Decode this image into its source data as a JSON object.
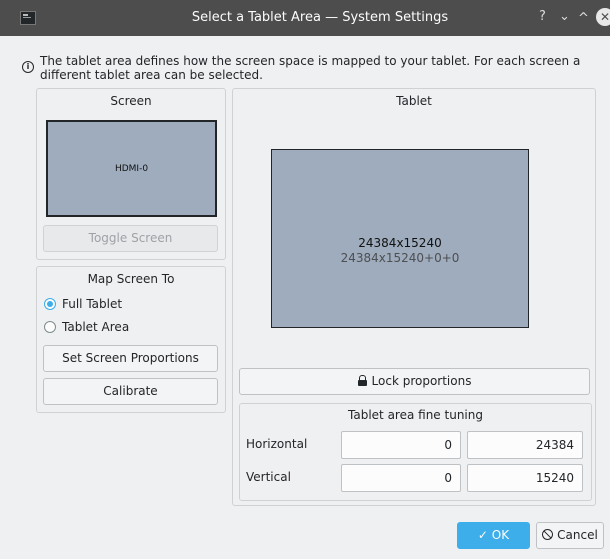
{
  "window": {
    "title": "Select a Tablet Area — System Settings",
    "help_glyph": "?",
    "minimize_glyph": "⌄",
    "maximize_glyph": "^",
    "close_glyph": "✕"
  },
  "info": {
    "icon_glyph": "i",
    "text": "The tablet area defines how the screen space is mapped to your tablet. For each screen a different tablet area can be selected."
  },
  "screen_panel": {
    "title": "Screen",
    "screen_name": "HDMI-0",
    "toggle_label": "Toggle Screen"
  },
  "map_panel": {
    "title": "Map Screen To",
    "options": [
      {
        "label": "Full Tablet",
        "checked": true
      },
      {
        "label": "Tablet Area",
        "checked": false
      }
    ],
    "set_proportions_label": "Set Screen Proportions",
    "calibrate_label": "Calibrate"
  },
  "tablet_panel": {
    "title": "Tablet",
    "size_text": "24384x15240",
    "geometry_text": "24384x15240+0+0",
    "lock_label": "Lock proportions"
  },
  "fine_tuning": {
    "title": "Tablet area fine tuning",
    "horizontal_label": "Horizontal",
    "horizontal_start": "0",
    "horizontal_end": "24384",
    "vertical_label": "Vertical",
    "vertical_start": "0",
    "vertical_end": "15240"
  },
  "footer": {
    "ok_glyph": "✓",
    "ok_label": "OK",
    "cancel_label": "Cancel"
  },
  "colors": {
    "accent": "#3daee9",
    "titlebar": "#4d4d4d",
    "area_fill": "#9eacbd"
  }
}
